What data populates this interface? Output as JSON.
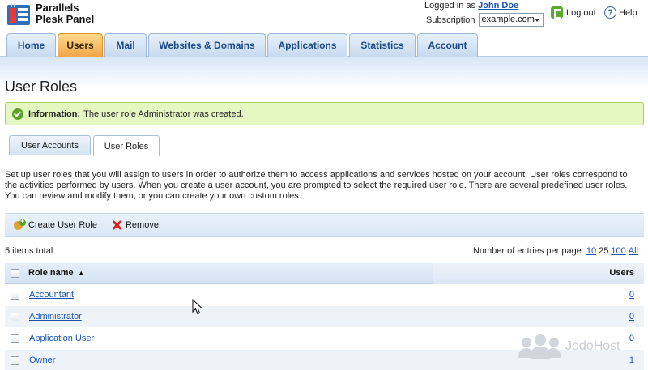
{
  "header": {
    "brand_line1": "Parallels",
    "brand_line2": "Plesk Panel",
    "logged_in_label": "Logged in as",
    "user_name": "John Doe",
    "subscription_label": "Subscription",
    "subscription_value": "example.com",
    "logout_label": "Log out",
    "help_label": "Help"
  },
  "nav": {
    "tabs": [
      {
        "label": "Home"
      },
      {
        "label": "Users"
      },
      {
        "label": "Mail"
      },
      {
        "label": "Websites & Domains"
      },
      {
        "label": "Applications"
      },
      {
        "label": "Statistics"
      },
      {
        "label": "Account"
      }
    ],
    "active": "Users"
  },
  "page": {
    "title": "User Roles",
    "info_label": "Information:",
    "info_text": "The user role Administrator was created."
  },
  "subtabs": [
    {
      "label": "User Accounts"
    },
    {
      "label": "User Roles"
    }
  ],
  "description": "Set up user roles that you will assign to users in order to authorize them to access applications and services hosted on your account. User roles correspond to the activities performed by users. When you create a user account, you are prompted to select the required user role. There are several predefined user roles. You can review and modify them, or you can create your own custom roles.",
  "toolbar": {
    "create_label": "Create User Role",
    "remove_label": "Remove"
  },
  "list": {
    "total_label": "5 items total",
    "per_page_label": "Number of entries per page:",
    "per_page_options": [
      "10",
      "25",
      "100",
      "All"
    ],
    "per_page_current": "25",
    "columns": {
      "name": "Role name",
      "sort_marker": "▲",
      "users": "Users"
    },
    "rows": [
      {
        "name": "Accountant",
        "users": "0"
      },
      {
        "name": "Administrator",
        "users": "0"
      },
      {
        "name": "Application User",
        "users": "0"
      },
      {
        "name": "Owner",
        "users": "1"
      }
    ]
  },
  "watermark": "JodoHost",
  "colors": {
    "active_tab": "#f1a64a",
    "tab": "#c7daf0",
    "info_bg": "#e6f8c2",
    "link": "#1a55b0"
  }
}
